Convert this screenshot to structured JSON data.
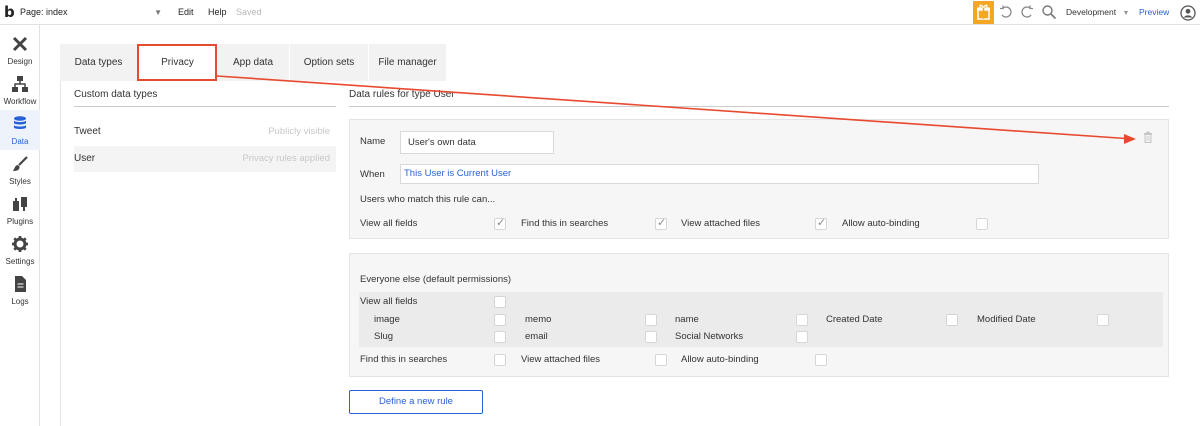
{
  "topbar": {
    "logo": "b",
    "page_select": "Page: index",
    "menus": [
      "Edit",
      "Help"
    ],
    "save_status": "Saved",
    "environment": "Development",
    "preview": "Preview",
    "icons": [
      "gift-icon",
      "undo-icon",
      "redo-icon",
      "search-icon",
      "user-icon"
    ],
    "gift_color": "#f5a623"
  },
  "leftnav": {
    "items": [
      {
        "label": "Design",
        "icon": "design-icon"
      },
      {
        "label": "Workflow",
        "icon": "workflow-icon"
      },
      {
        "label": "Data",
        "icon": "database-icon",
        "active": true
      },
      {
        "label": "Styles",
        "icon": "brush-icon"
      },
      {
        "label": "Plugins",
        "icon": "plugin-icon"
      },
      {
        "label": "Settings",
        "icon": "gear-icon"
      },
      {
        "label": "Logs",
        "icon": "document-icon"
      }
    ]
  },
  "tabs": [
    {
      "label": "Data types"
    },
    {
      "label": "Privacy",
      "active": true
    },
    {
      "label": "App data"
    },
    {
      "label": "Option sets"
    },
    {
      "label": "File manager"
    }
  ],
  "left_panel": {
    "title": "Custom data types",
    "types": [
      {
        "name": "Tweet",
        "status": "Publicly visible"
      },
      {
        "name": "User",
        "status": "Privacy rules applied",
        "selected": true
      }
    ]
  },
  "right_panel": {
    "title": "Data rules for type User",
    "rule": {
      "name_label": "Name",
      "name_value": "User's own data",
      "when_label": "When",
      "when_value": "This User is Current User",
      "can_label": "Users who match this rule can...",
      "permissions": [
        {
          "label": "View all fields",
          "checked": true
        },
        {
          "label": "Find this in searches",
          "checked": true
        },
        {
          "label": "View attached files",
          "checked": true
        },
        {
          "label": "Allow auto-binding",
          "checked": false
        }
      ]
    },
    "everyone_else": {
      "title": "Everyone else (default permissions)",
      "view_all_fields": "View all fields",
      "fields": [
        "image",
        "memo",
        "name",
        "Created Date",
        "Modified Date",
        "Slug",
        "email",
        "Social Networks"
      ],
      "bottom": [
        "Find this in searches",
        "View attached files",
        "Allow auto-binding"
      ]
    },
    "new_rule_button": "Define a new rule"
  },
  "annotation_color": "#e84a2f",
  "accent_color": "#2862d6"
}
